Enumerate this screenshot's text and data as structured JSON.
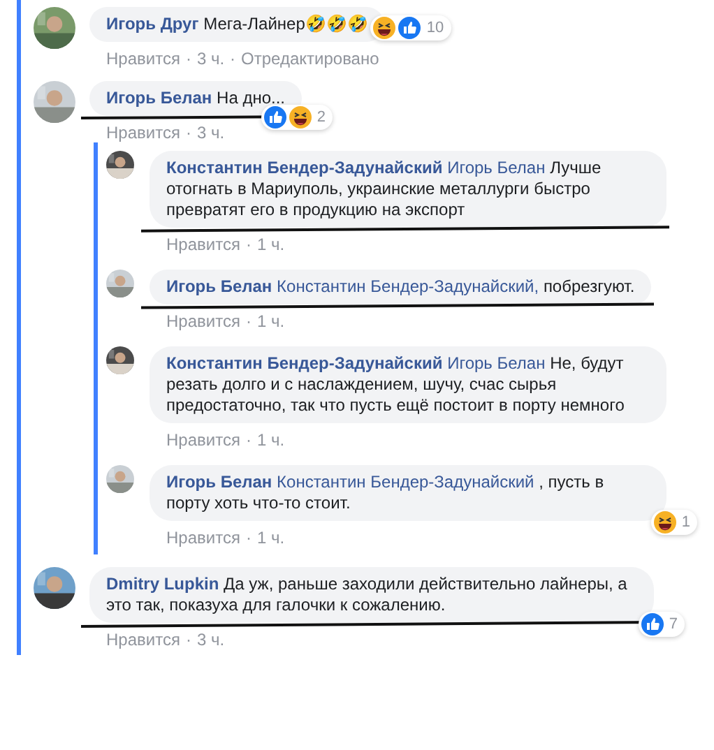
{
  "comments": [
    {
      "author": "Игорь Друг",
      "text": "Мега-Лайнер🤣🤣🤣",
      "highlighted": true,
      "underlined": false,
      "reactions": [
        {
          "kind": "haha"
        },
        {
          "kind": "like"
        }
      ],
      "reaction_count": "10",
      "badge_beside": true,
      "meta": [
        "Нравится",
        "·",
        "3 ч.",
        "·",
        "Отредактировано"
      ]
    },
    {
      "author": "Игорь Белан",
      "text": "На дно...",
      "highlighted": true,
      "underlined": true,
      "reactions": [
        {
          "kind": "like"
        },
        {
          "kind": "haha"
        }
      ],
      "reaction_count": "2",
      "badge_beside": false,
      "meta": [
        "Нравится",
        "·",
        "3 ч."
      ],
      "replies": [
        {
          "author": "Константин Бендер-Задунайский",
          "mention": "Игорь Белан",
          "text": "Лучше отогнать в Мариуполь, украинские металлурги быстро превратят его в продукцию на экспорт",
          "highlighted": true,
          "underlined": true,
          "meta": [
            "Нравится",
            "·",
            "1 ч."
          ]
        },
        {
          "author": "Игорь Белан",
          "mention": "Константин Бендер-Задунайский,",
          "text": "побрезгуют.",
          "highlighted": true,
          "underlined": true,
          "meta": [
            "Нравится",
            "·",
            "1 ч."
          ]
        },
        {
          "author": "Константин Бендер-Задунайский",
          "mention": "Игорь Белан",
          "text": "Не, будут резать долго и с наслаждением, шучу, счас сырья предостаточно, так что пусть ещё постоит в порту немного",
          "highlighted": true,
          "underlined": false,
          "meta": [
            "Нравится",
            "·",
            "1 ч."
          ]
        },
        {
          "author": "Игорь Белан",
          "mention": "Константин Бендер-Задунайский",
          "text": ", пусть в порту хоть что-то стоит.",
          "highlighted": true,
          "underlined": false,
          "reactions": [
            {
              "kind": "haha"
            }
          ],
          "reaction_count": "1",
          "badge_beside": false,
          "meta": [
            "Нравится",
            "·",
            "1 ч."
          ]
        }
      ]
    },
    {
      "author": "Dmitry Lupkin",
      "text": "Да уж, раньше заходили действительно лайнеры, а это так, показуха для галочки к сожалению.",
      "highlighted": true,
      "underlined": true,
      "reactions": [
        {
          "kind": "like"
        }
      ],
      "reaction_count": "7",
      "badge_beside": false,
      "meta": [
        "Нравится",
        "·",
        "3 ч."
      ]
    }
  ]
}
